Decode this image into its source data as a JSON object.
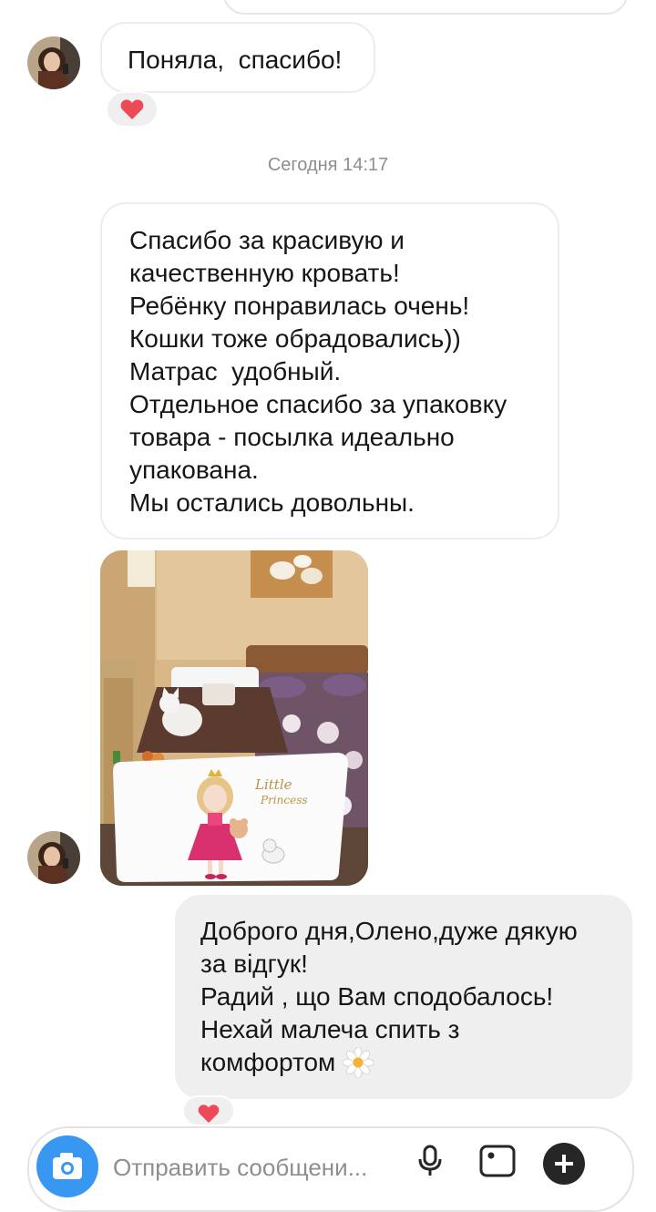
{
  "messages": [
    {
      "direction": "incoming",
      "lines": [
        "Поняла,  спасибо!"
      ],
      "reaction": "heart-icon"
    },
    {
      "timestamp": "Сегодня 14:17"
    },
    {
      "direction": "incoming",
      "lines": [
        "Спасибо за красивую и",
        "качественную кровать!",
        "Ребёнку понравилась очень!",
        "Кошки тоже обрадовались))",
        "Матрас  удобный.",
        "Отдельное спасибо за упаковку",
        "товара - посылка идеально",
        "упакована.",
        "Мы остались довольны."
      ]
    },
    {
      "direction": "incoming",
      "type": "photo",
      "photo_text": [
        "Little",
        "Princess"
      ]
    },
    {
      "direction": "outgoing",
      "lines": [
        "Доброго дня,Олено,дуже дякую",
        "за відгук!",
        "Радий , що Вам сподобалось!",
        "Нехай малеча спить з",
        "комфортом"
      ],
      "emoji": "daisy-icon",
      "reaction": "heart-icon"
    }
  ],
  "composer": {
    "placeholder": "Отправить сообщени..."
  },
  "colors": {
    "accent": "#3897f0",
    "reaction_heart": "#ed4956",
    "timestamp": "#8e8e8e",
    "outgoing_bubble": "#efefef"
  }
}
